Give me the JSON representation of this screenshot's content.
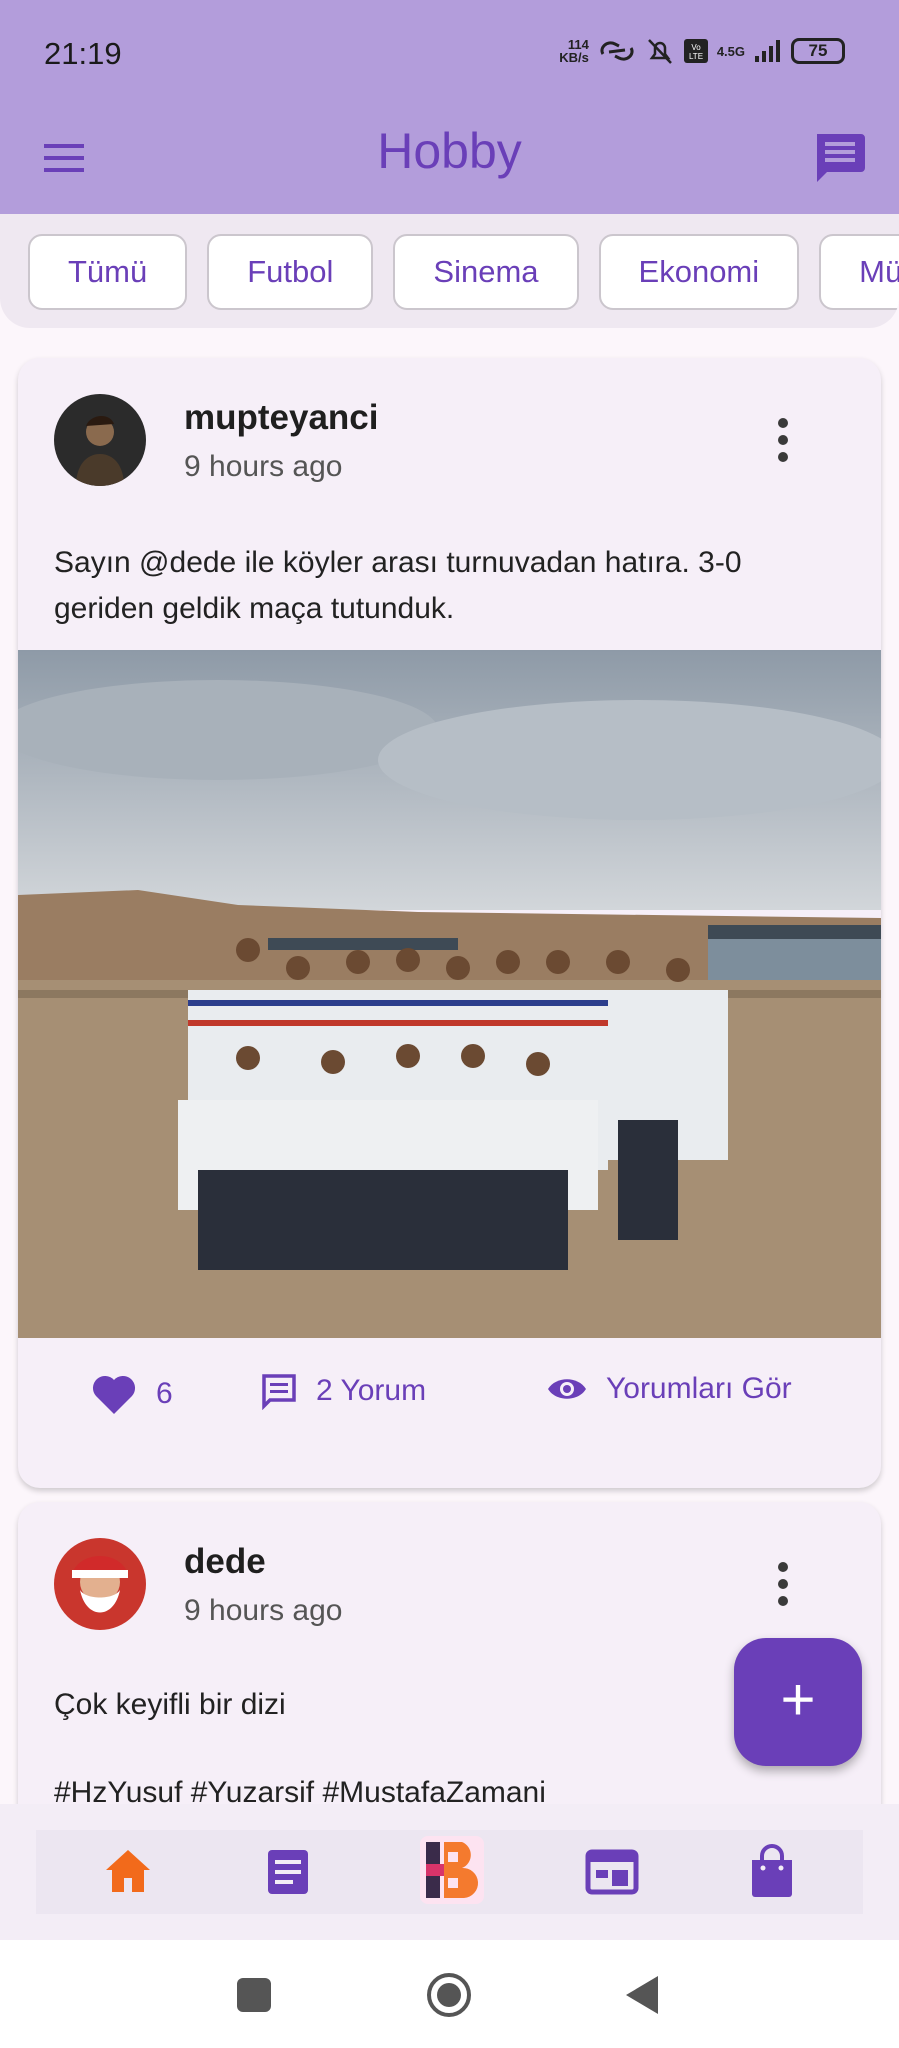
{
  "status_bar": {
    "time": "21:19",
    "net_speed_value": "114",
    "net_speed_unit": "KB/s",
    "network": "4.5G",
    "battery": "75"
  },
  "app_bar": {
    "title": "Hobby",
    "menu_icon": "hamburger-menu-icon",
    "chat_icon": "chat-icon"
  },
  "categories": [
    "Tümü",
    "Futbol",
    "Sinema",
    "Ekonomi",
    "Müz"
  ],
  "posts": [
    {
      "username": "mupteyanci",
      "time": "9 hours ago",
      "text": "Sayın @dede ile köyler arası turnuvadan hatıra. 3-0 geriden geldik maça tutunduk.",
      "likes": "6",
      "comments_label": "2 Yorum",
      "view_comments_label": "Yorumları Gör"
    },
    {
      "username": "dede",
      "time": "9 hours ago",
      "text": "Çok keyifli bir dizi",
      "hashtags": "#HzYusuf #Yuzarsif #MustafaZamani"
    }
  ],
  "fab": {
    "label": "+"
  },
  "bottom_nav": [
    "home-icon",
    "article-icon",
    "logo-icon",
    "calendar-icon",
    "shopping-bag-icon"
  ],
  "colors": {
    "primary": "#6a3fb8",
    "header_bg": "#b39ddb",
    "home_active": "#f26a1b"
  }
}
